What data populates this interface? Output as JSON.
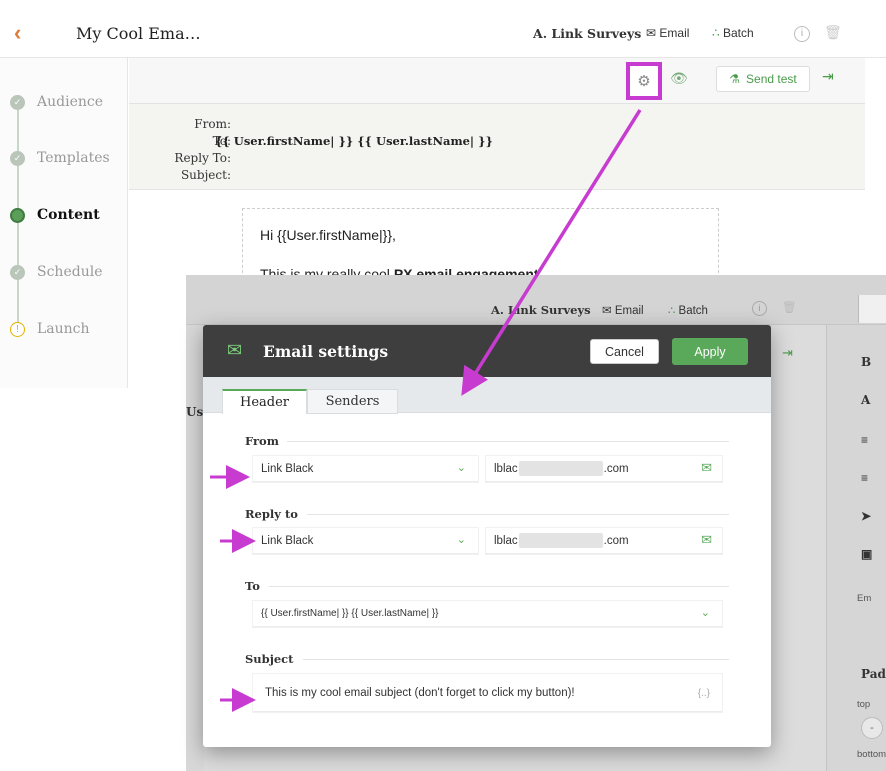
{
  "bg_app": {
    "title": "My Cool Ema…",
    "survey_label": "A. Link Surveys",
    "email_label": "Email",
    "batch_label": "Batch",
    "steps": [
      {
        "label": "Audience",
        "state": "done"
      },
      {
        "label": "Templates",
        "state": "done"
      },
      {
        "label": "Content",
        "state": "current"
      },
      {
        "label": "Schedule",
        "state": "done"
      },
      {
        "label": "Launch",
        "state": "warning"
      }
    ],
    "send_test_label": "Send test",
    "header": {
      "from_label": "From:",
      "to_label": "To:",
      "to_value": "{{ User.firstName| }} {{ User.lastName| }}",
      "reply_to_label": "Reply To:",
      "subject_label": "Subject:"
    },
    "email_body": {
      "greeting": "Hi {{User.firstName|}},",
      "line2_prefix": "This is my really cool ",
      "line2_bold": "PX email engagement"
    }
  },
  "overlay": {
    "survey_label": "A. Link Surveys",
    "email_label": "Email",
    "batch_label": "Batch",
    "left_clip": "Us",
    "right_panel": {
      "b": "B",
      "a": "A",
      "em": "Em",
      "padding": "Paddi",
      "top": "top",
      "bottom": "bottom",
      "minus": "-"
    }
  },
  "modal": {
    "title": "Email settings",
    "cancel_label": "Cancel",
    "apply_label": "Apply",
    "tabs": [
      "Header",
      "Senders"
    ],
    "active_tab": "Header",
    "from": {
      "label": "From",
      "sender": "Link Black",
      "email_start": "lblac",
      "email_end": ".com"
    },
    "reply_to": {
      "label": "Reply to",
      "sender": "Link Black",
      "email_start": "lblac",
      "email_end": ".com"
    },
    "to": {
      "label": "To",
      "value": "{{ User.firstName| }} {{ User.lastName| }}"
    },
    "subject": {
      "label": "Subject",
      "value": "This is my cool email subject (don't forget to click my button)!",
      "braces": "{..}"
    }
  },
  "colors": {
    "annotation": "#c83bd0",
    "accent_green": "#5aa85a",
    "modal_header": "#3e3e3e",
    "back_chevron": "#e07b39"
  }
}
